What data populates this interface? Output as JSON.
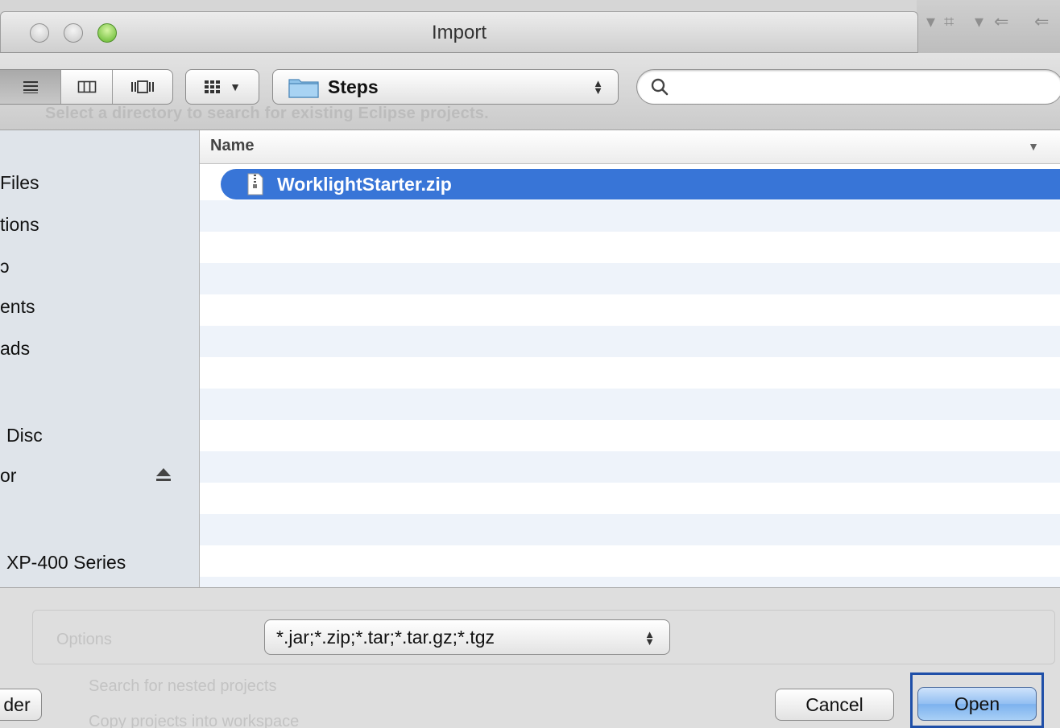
{
  "window": {
    "title": "Import"
  },
  "background_dialog": {
    "hint": "Select a directory to search for existing Eclipse projects.",
    "options_label": "Options",
    "checkbox_1": "Search for nested projects",
    "checkbox_2": "Copy projects into workspace"
  },
  "toolbar": {
    "view_modes": [
      "list-view-icon",
      "column-view-icon",
      "coverflow-view-icon"
    ],
    "active_view": "list-view-icon",
    "arrange_icon": "arrange-grid-icon",
    "path_popup": {
      "folder_icon": "folder-icon",
      "label": "Steps"
    },
    "search": {
      "placeholder": "",
      "value": ""
    }
  },
  "sidebar": {
    "items": [
      {
        "label": "Files"
      },
      {
        "label": "tions"
      },
      {
        "label": "ɔ"
      },
      {
        "label": "ents"
      },
      {
        "label": "ads"
      },
      {
        "label": "Disc"
      },
      {
        "label": "or",
        "icon": "eject-icon"
      },
      {
        "label": "XP-400 Series"
      }
    ]
  },
  "file_list": {
    "columns": [
      {
        "label": "Name",
        "sort": "descending"
      }
    ],
    "rows": [
      {
        "name": "WorklightStarter.zip",
        "icon": "zip-file-icon",
        "selected": true
      }
    ]
  },
  "filter": {
    "value": "*.jar;*.zip;*.tar;*.tar.gz;*.tgz"
  },
  "buttons": {
    "new_folder": "der",
    "cancel": "Cancel",
    "open": "Open"
  },
  "colors": {
    "selection": "#3875d7",
    "sidebar_bg": "#dfe4ea",
    "focus_ring": "#1f4fa8",
    "alt_row": "#eef3fa"
  }
}
